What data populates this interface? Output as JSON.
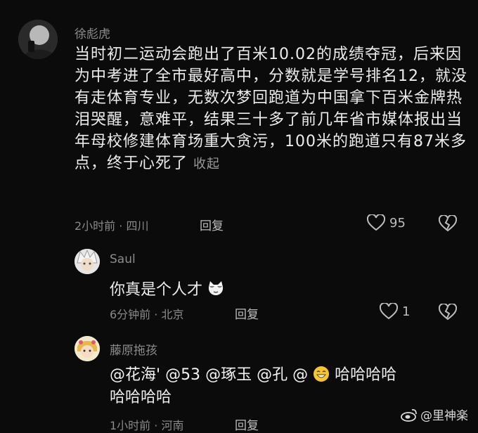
{
  "comment1": {
    "username": "徐彪虎",
    "text": "当时初二运动会跑出了百米10.02的成绩夺冠，后来因为中考进了全市最好高中，分数就是学号排名12，就没有走体育专业，无数次梦回跑道为中国拿下百米金牌热泪哭醒，意难平，结果三十多了前几年省市媒体报出当年母校修建体育场重大贪污，100米的跑道只有87米多点，终于心死了",
    "collapse_label": "收起",
    "time": "2小时前",
    "location": "四川",
    "reply_label": "回复",
    "likes": "95"
  },
  "reply1": {
    "username": "Saul",
    "text": "你真是个人才",
    "time": "6分钟前",
    "location": "北京",
    "reply_label": "回复",
    "likes": "1"
  },
  "reply2": {
    "username": "藤原拖孩",
    "mentions": [
      "@花海'",
      "@53",
      "@琢玉",
      "@孔",
      "@"
    ],
    "text_after": "哈哈哈哈",
    "text_line2": "哈哈哈哈",
    "time": "1小时前",
    "location": "河南",
    "reply_label": "回复"
  },
  "watermark": "@里神楽",
  "separator": "·",
  "icons": [
    "heart-icon",
    "broken-heart-icon",
    "cat-emoji-icon",
    "grin-emoji-icon",
    "weibo-logo-icon"
  ]
}
